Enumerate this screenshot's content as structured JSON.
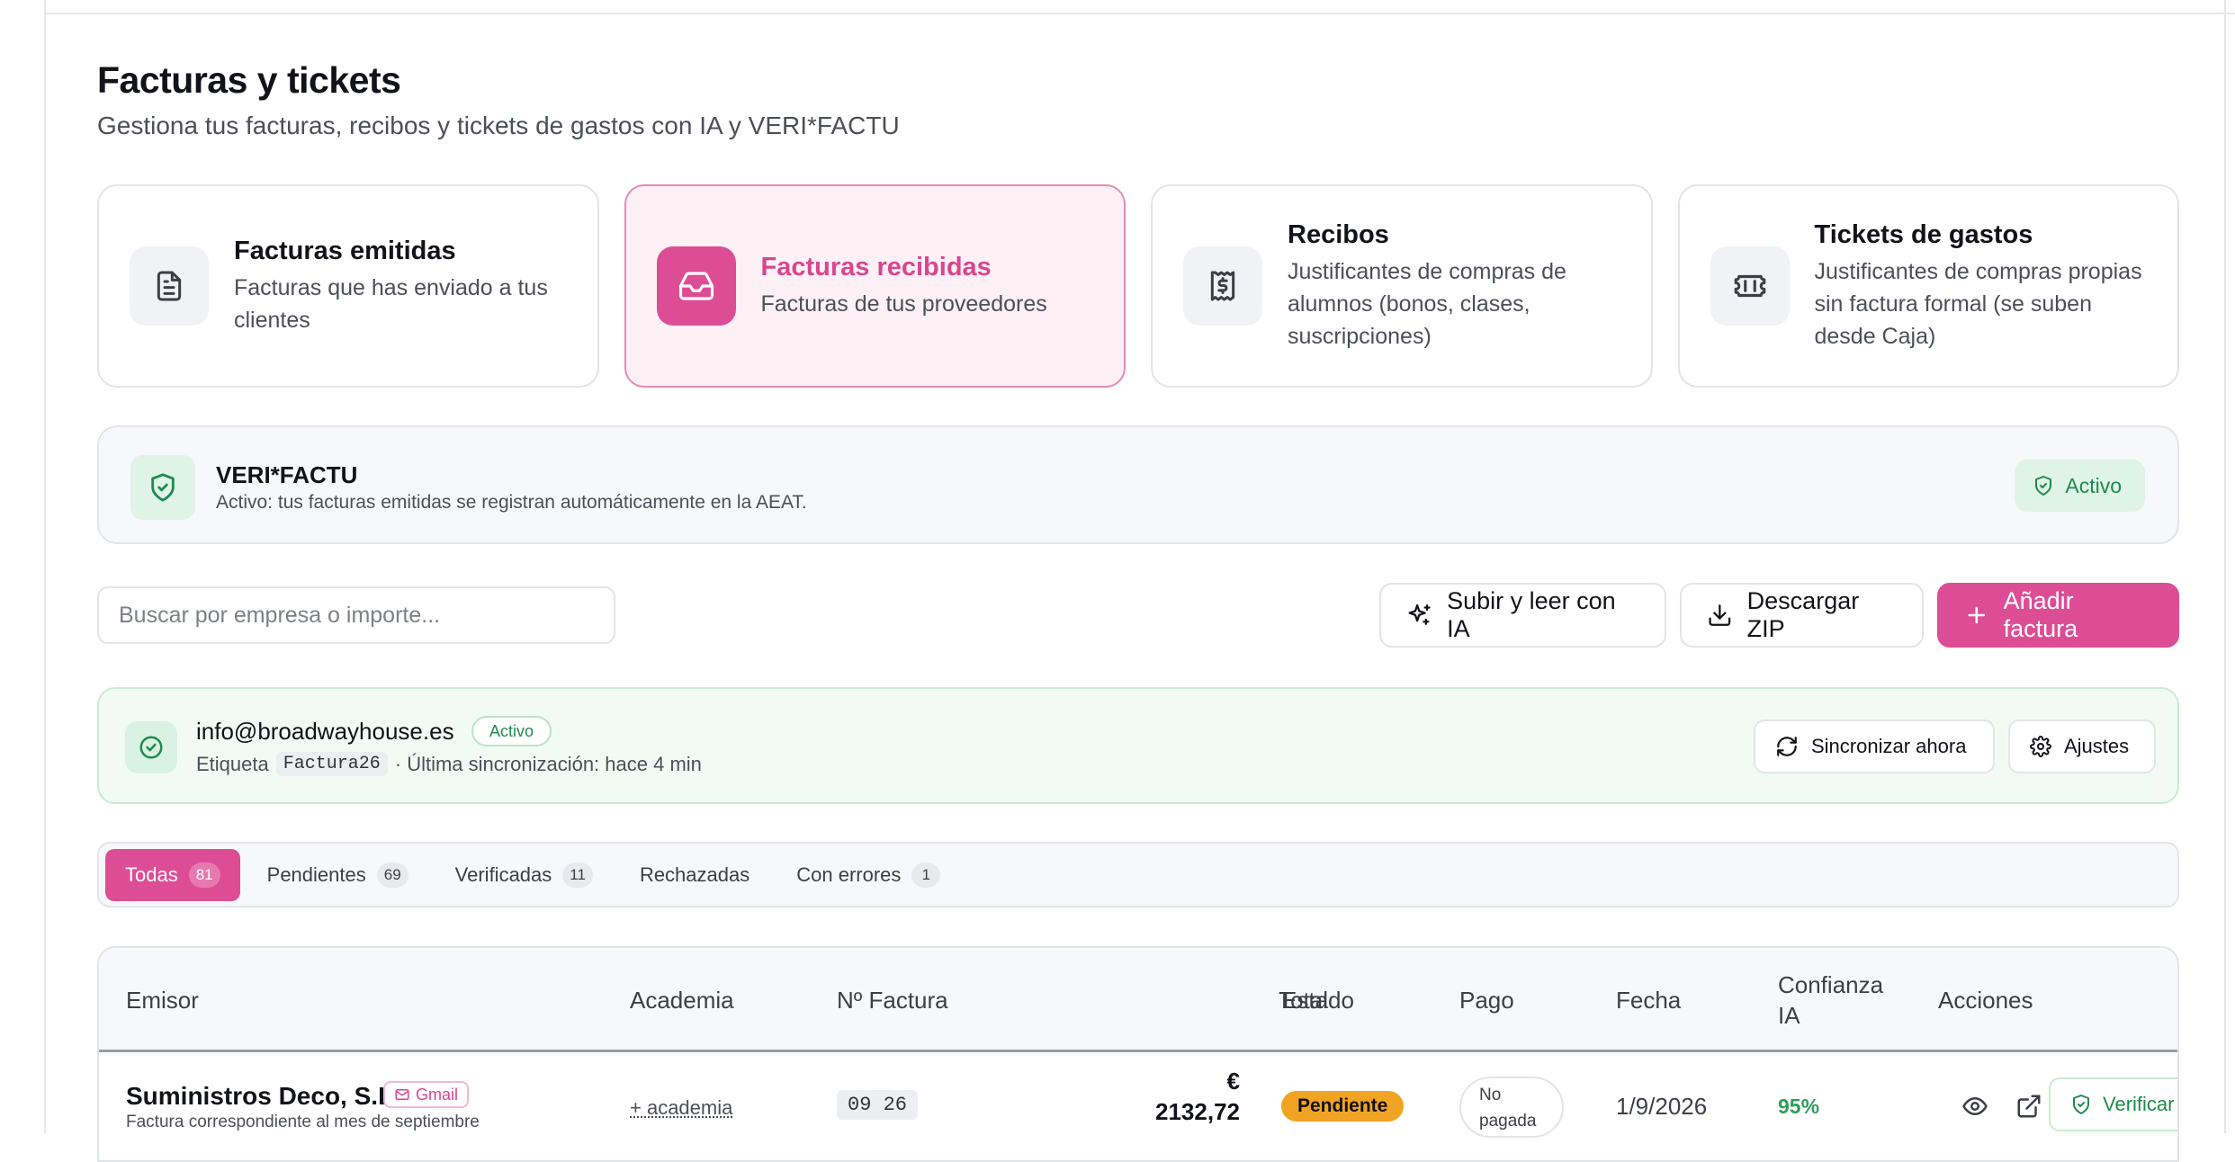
{
  "page": {
    "title": "Facturas y tickets",
    "subtitle": "Gestiona tus facturas, recibos y tickets de gastos con IA y VERI*FACTU"
  },
  "cards": [
    {
      "title": "Facturas emitidas",
      "description": "Facturas que has enviado a tus clientes",
      "icon": "document-icon"
    },
    {
      "title": "Facturas recibidas",
      "description": "Facturas de tus proveedores",
      "icon": "inbox-icon"
    },
    {
      "title": "Recibos",
      "description": "Justificantes de compras de alumnos (bonos, clases, suscripciones)",
      "icon": "receipt-dollar-icon"
    },
    {
      "title": "Tickets de gastos",
      "description": "Justificantes de compras propias sin factura formal (se suben desde Caja)",
      "icon": "ticket-icon"
    }
  ],
  "verifactu": {
    "title": "VERI*FACTU",
    "description": "Activo: tus facturas emitidas se registran automáticamente en la AEAT.",
    "badge": "Activo"
  },
  "toolbar": {
    "search_placeholder": "Buscar por empresa o importe...",
    "upload_label": "Subir y leer con IA",
    "download_label": "Descargar ZIP",
    "add_label": "Añadir factura"
  },
  "sync": {
    "email": "info@broadwayhouse.es",
    "status": "Activo",
    "tag_prefix": "Etiqueta",
    "tag": "Factura26",
    "last_sync": "· Última sincronización: hace 4 min",
    "sync_label": "Sincronizar ahora",
    "settings_label": "Ajustes"
  },
  "tabs": [
    {
      "label": "Todas",
      "count": "81"
    },
    {
      "label": "Pendientes",
      "count": "69"
    },
    {
      "label": "Verificadas",
      "count": "11"
    },
    {
      "label": "Rechazadas",
      "count": ""
    },
    {
      "label": "Con errores",
      "count": "1"
    }
  ],
  "table": {
    "headers": {
      "emisor": "Emisor",
      "academia": "Academia",
      "numero": "Nº Factura",
      "total": "Total",
      "estado": "Estado",
      "pago": "Pago",
      "fecha": "Fecha",
      "confianza": "Confianza IA",
      "acciones": "Acciones"
    },
    "rows": [
      {
        "emisor": "Suministros Deco, S.L.",
        "source": "Gmail",
        "descripcion": "Factura correspondiente al mes de septiembre",
        "academia": "+ academia",
        "numero": "09 26",
        "total_currency": "€",
        "total": "2132,72",
        "estado": "Pendiente",
        "pago": "No pagada",
        "fecha": "1/9/2026",
        "confianza": "95%",
        "verify_label": "Verificar"
      }
    ]
  },
  "colors": {
    "accent": "#dd4d96",
    "success": "#1f8a4f",
    "pending": "#f1a424"
  }
}
